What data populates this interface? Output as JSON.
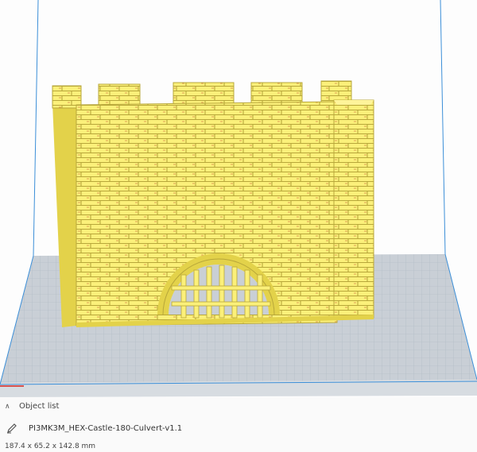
{
  "viewport": {
    "background": "#fdfdfd",
    "build_plate_color": "#c9cfd6",
    "grid_color": "#a7b2bd",
    "frame_color": "#3c8fd8",
    "model_color": "#fbf07a",
    "model_shadow_color": "#e3d24a",
    "mortar_color": "#b8a73a",
    "mortar_accent_color": "#c4522e"
  },
  "object_list": {
    "header_label": "Object list",
    "header_icon": "chevron-up-icon",
    "file_icon": "pencil-icon",
    "file_name": "PI3MK3M_HEX-Castle-180-Culvert-v1.1",
    "dimensions": "187.4 x 65.2 x 142.8 mm"
  }
}
